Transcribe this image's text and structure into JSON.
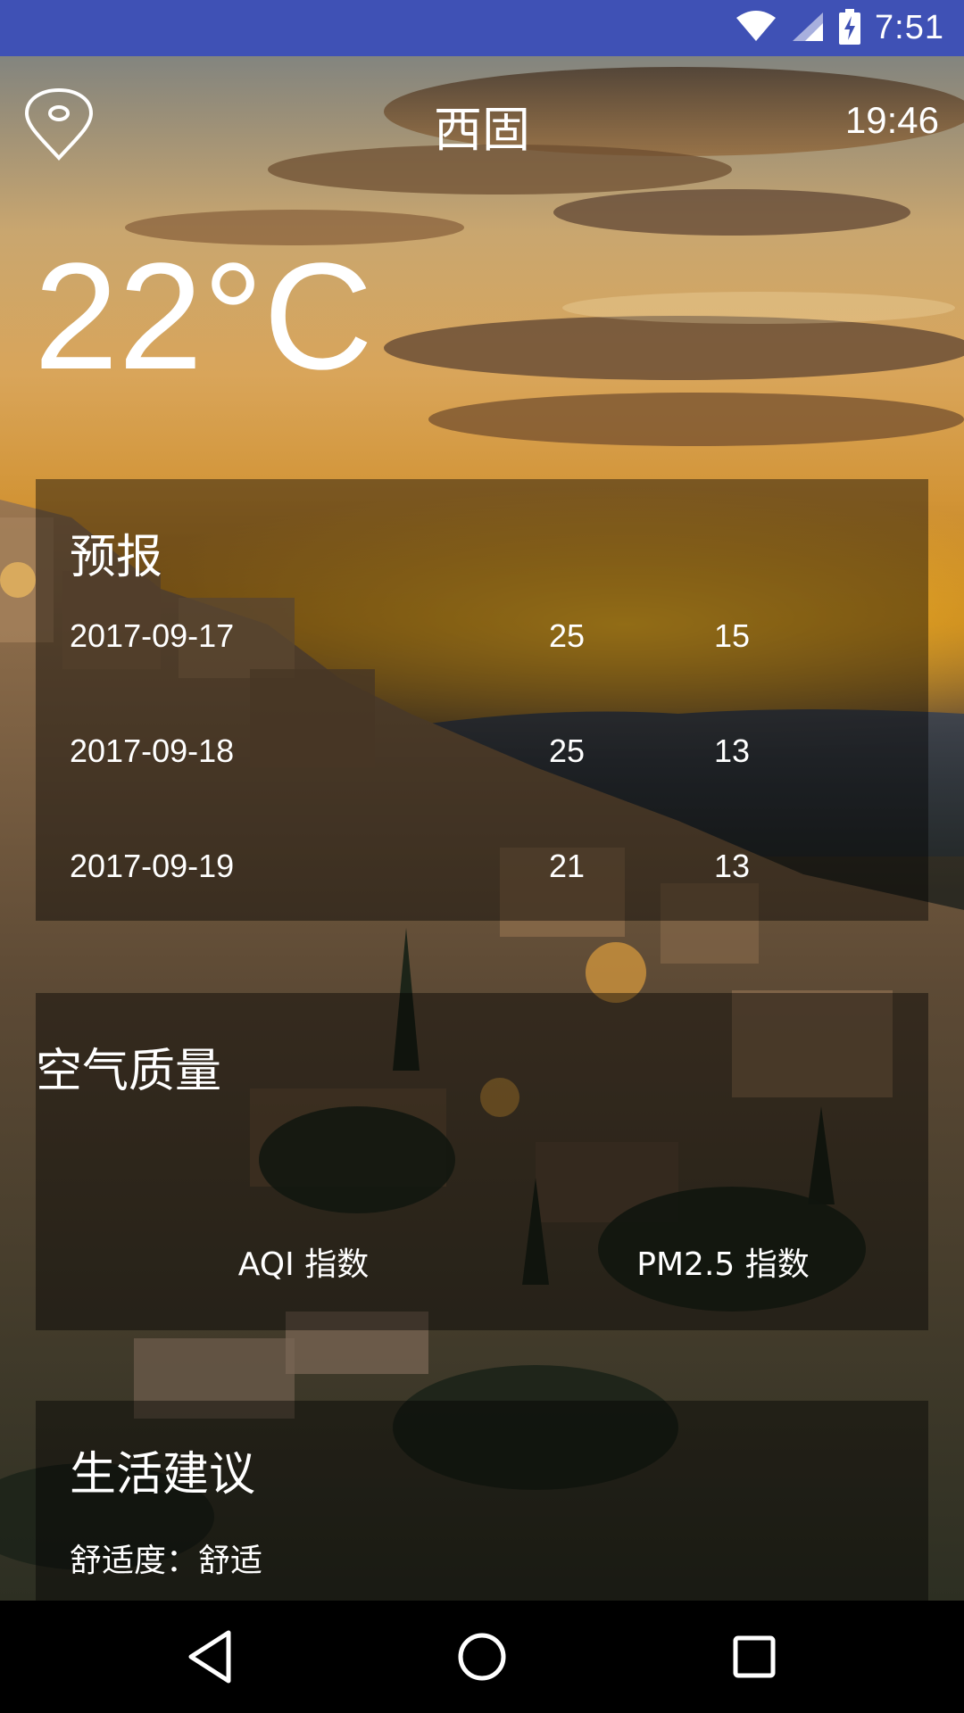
{
  "status_bar": {
    "time": "7:51",
    "icons": [
      "wifi-icon",
      "cell-signal-icon",
      "battery-charging-icon"
    ]
  },
  "header": {
    "location_icon": "location-pin-icon",
    "city": "西固",
    "update_time": "19:46"
  },
  "now": {
    "temperature": "22°C"
  },
  "forecast": {
    "title": "预报",
    "rows": [
      {
        "date": "2017-09-17",
        "max": "25",
        "min": "15"
      },
      {
        "date": "2017-09-18",
        "max": "25",
        "min": "13"
      },
      {
        "date": "2017-09-19",
        "max": "21",
        "min": "13"
      }
    ]
  },
  "aqi": {
    "title": "空气质量",
    "aqi_label": "AQI 指数",
    "pm25_label": "PM2.5 指数"
  },
  "suggestion": {
    "title": "生活建议",
    "comfort": "舒适度：舒适"
  },
  "nav": {
    "buttons": [
      "back-icon",
      "home-icon",
      "recents-icon"
    ]
  }
}
